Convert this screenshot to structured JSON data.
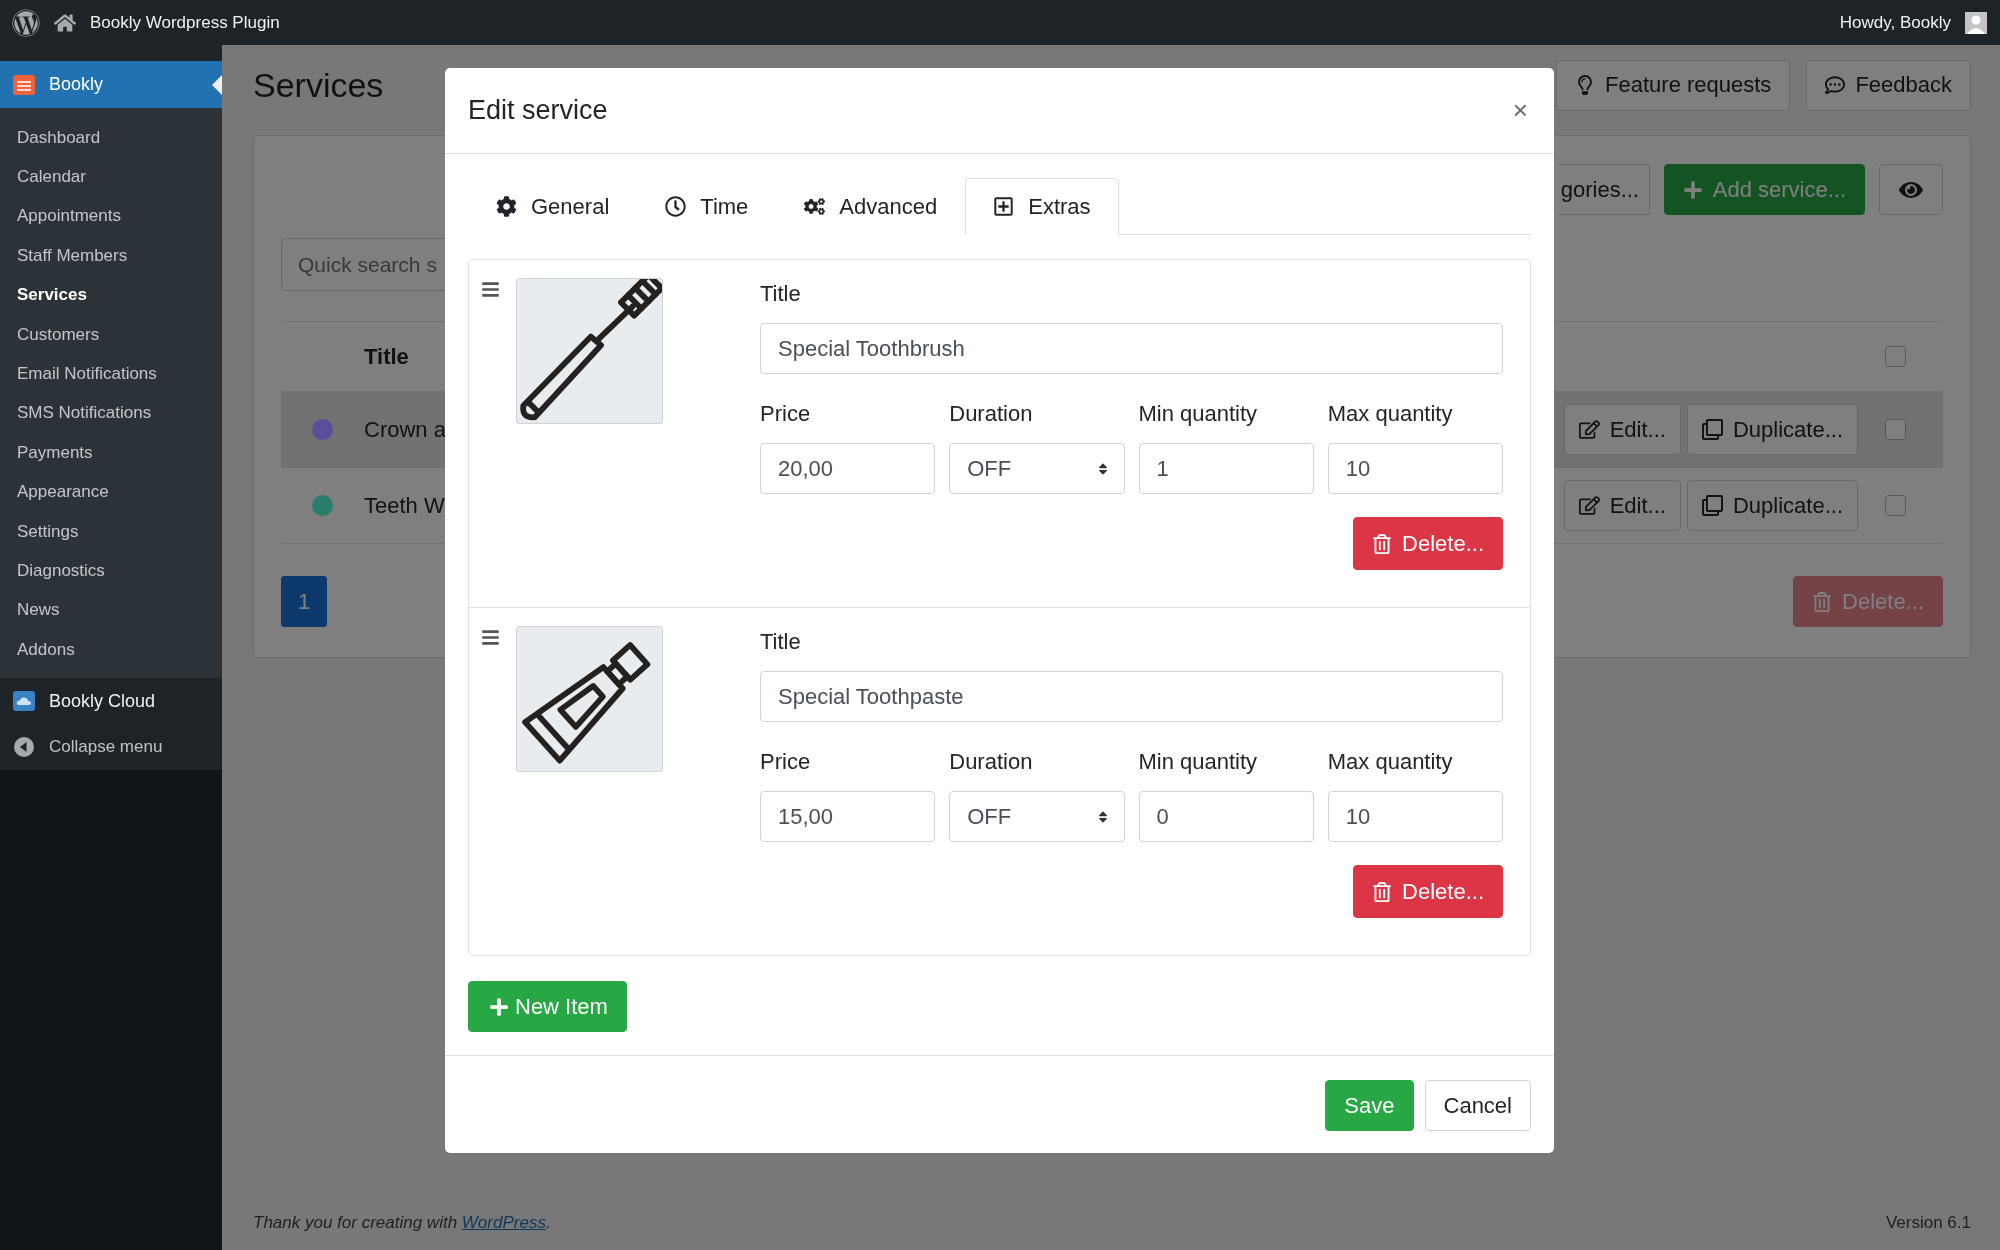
{
  "admin_bar": {
    "site_title": "Bookly Wordpress Plugin",
    "greeting": "Howdy, Bookly"
  },
  "sidebar": {
    "plugin": {
      "label": "Bookly",
      "selected": true
    },
    "items": [
      {
        "label": "Dashboard",
        "selected": false
      },
      {
        "label": "Calendar",
        "selected": false
      },
      {
        "label": "Appointments",
        "selected": false
      },
      {
        "label": "Staff Members",
        "selected": false
      },
      {
        "label": "Services",
        "selected": true
      },
      {
        "label": "Customers",
        "selected": false
      },
      {
        "label": "Email Notifications",
        "selected": false
      },
      {
        "label": "SMS Notifications",
        "selected": false
      },
      {
        "label": "Payments",
        "selected": false
      },
      {
        "label": "Appearance",
        "selected": false
      },
      {
        "label": "Settings",
        "selected": false
      },
      {
        "label": "Diagnostics",
        "selected": false
      },
      {
        "label": "News",
        "selected": false
      },
      {
        "label": "Addons",
        "selected": false
      }
    ],
    "cloud": "Bookly Cloud",
    "collapse": "Collapse menu"
  },
  "page": {
    "title": "Services",
    "header_buttons": [
      {
        "label": "Feature requests"
      },
      {
        "label": "Feedback"
      }
    ],
    "categories_button": "gories...",
    "add_button": "Add service...",
    "search": {
      "placeholder": "Quick search s"
    },
    "table": {
      "columns": [
        "Title"
      ],
      "select_all_checked": false,
      "rows": [
        {
          "title": "Crown a",
          "color": "#5b4f9b",
          "highlighted": true,
          "actions": [
            "Edit...",
            "Duplicate..."
          ],
          "checked": false
        },
        {
          "title": "Teeth W",
          "color": "#2a7d6b",
          "highlighted": false,
          "actions": [
            "Edit...",
            "Duplicate..."
          ],
          "checked": false
        }
      ]
    },
    "pagination": [
      {
        "label": "1",
        "selected": true
      }
    ],
    "delete_button": {
      "label": "Delete...",
      "disabled": true
    }
  },
  "footer": {
    "text": "Thank you for creating with ",
    "link": "WordPress",
    "after": ".",
    "version": "Version 6.1"
  },
  "modal": {
    "title": "Edit service",
    "close": "×",
    "tabs": [
      {
        "label": "General",
        "selected": false
      },
      {
        "label": "Time",
        "selected": false
      },
      {
        "label": "Advanced",
        "selected": false
      },
      {
        "label": "Extras",
        "selected": true
      }
    ],
    "extras": [
      {
        "kind": "toothbrush",
        "title_label": "Title",
        "title": "Special Toothbrush",
        "fields": [
          {
            "kind": "input",
            "label": "Price",
            "value": "20,00"
          },
          {
            "kind": "select",
            "label": "Duration",
            "value": "OFF"
          },
          {
            "kind": "input",
            "label": "Min quantity",
            "value": "1"
          },
          {
            "kind": "input",
            "label": "Max quantity",
            "value": "10"
          }
        ],
        "delete": "Delete..."
      },
      {
        "kind": "toothpaste",
        "title_label": "Title",
        "title": "Special Toothpaste",
        "fields": [
          {
            "kind": "input",
            "label": "Price",
            "value": "15,00"
          },
          {
            "kind": "select",
            "label": "Duration",
            "value": "OFF"
          },
          {
            "kind": "input",
            "label": "Min quantity",
            "value": "0"
          },
          {
            "kind": "input",
            "label": "Max quantity",
            "value": "10"
          }
        ],
        "delete": "Delete..."
      }
    ],
    "new_item": "New Item",
    "save": "Save",
    "cancel": "Cancel"
  }
}
